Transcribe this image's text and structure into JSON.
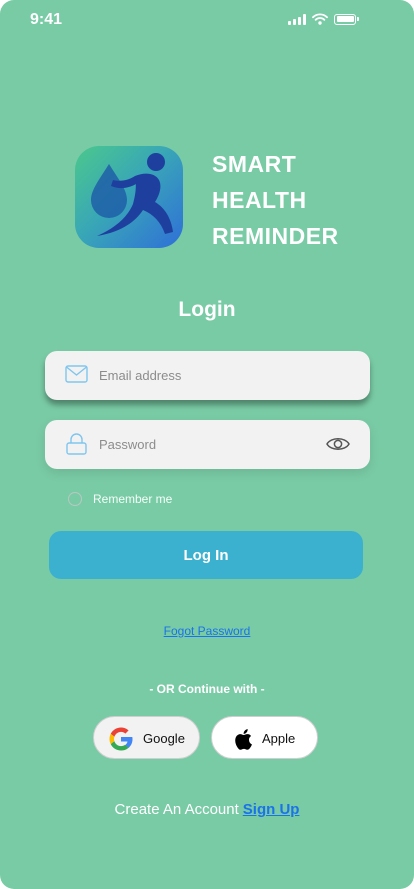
{
  "status_bar": {
    "time": "9:41"
  },
  "app": {
    "title_lines": [
      "SMART",
      "HEALTH",
      "REMINDER"
    ]
  },
  "login": {
    "heading": "Login",
    "email_placeholder": "Email address",
    "password_placeholder": "Password",
    "remember_label": "Remember me",
    "login_button": "Log In",
    "forgot_link": "Fogot Password"
  },
  "social": {
    "divider_text": "- OR Continue with -",
    "google_label": "Google",
    "apple_label": "Apple"
  },
  "signup": {
    "prompt": "Create An Account",
    "link": "Sign Up"
  },
  "colors": {
    "background": "#79cba5",
    "primary_button": "#3cb1cf",
    "link": "#1a73e8"
  }
}
